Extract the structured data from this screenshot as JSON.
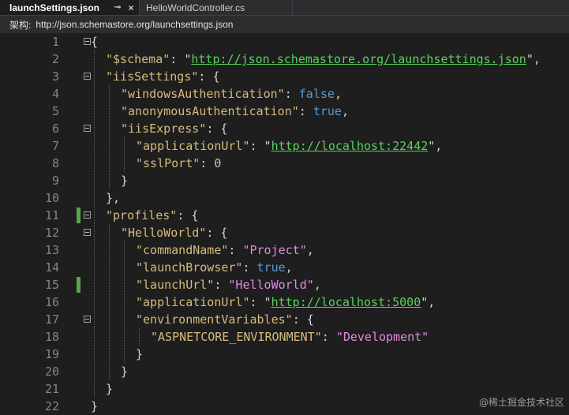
{
  "tabs": [
    {
      "label": "launchSettings.json",
      "pin_icon": "⊸",
      "close_icon": "×"
    },
    {
      "label": "HelloWorldController.cs"
    }
  ],
  "schema_bar": {
    "label": "架构:",
    "url": "http://json.schemastore.org/launchsettings.json"
  },
  "lines": [
    {
      "n": "1"
    },
    {
      "n": "2"
    },
    {
      "n": "3"
    },
    {
      "n": "4"
    },
    {
      "n": "5"
    },
    {
      "n": "6"
    },
    {
      "n": "7"
    },
    {
      "n": "8"
    },
    {
      "n": "9"
    },
    {
      "n": "10"
    },
    {
      "n": "11"
    },
    {
      "n": "12"
    },
    {
      "n": "13"
    },
    {
      "n": "14"
    },
    {
      "n": "15"
    },
    {
      "n": "16"
    },
    {
      "n": "17"
    },
    {
      "n": "18"
    },
    {
      "n": "19"
    },
    {
      "n": "20"
    },
    {
      "n": "21"
    },
    {
      "n": "22"
    }
  ],
  "code": {
    "schema_key": "\"$schema\"",
    "schema_val": "http://json.schemastore.org/launchsettings.json",
    "iis_key": "\"iisSettings\"",
    "winauth_key": "\"windowsAuthentication\"",
    "winauth_val": "false",
    "anon_key": "\"anonymousAuthentication\"",
    "anon_val": "true",
    "iisexpress_key": "\"iisExpress\"",
    "appurl_key": "\"applicationUrl\"",
    "appurl_val": "http://localhost:22442",
    "ssl_key": "\"sslPort\"",
    "ssl_val": "0",
    "profiles_key": "\"profiles\"",
    "hw_key": "\"HelloWorld\"",
    "cmd_key": "\"commandName\"",
    "cmd_val": "\"Project\"",
    "browser_key": "\"launchBrowser\"",
    "browser_val": "true",
    "launchurl_key": "\"launchUrl\"",
    "launchurl_val": "\"HelloWorld\"",
    "appurl2_key": "\"applicationUrl\"",
    "appurl2_val": "http://localhost:5000",
    "env_key": "\"environmentVariables\"",
    "aspenv_key": "\"ASPNETCORE_ENVIRONMENT\"",
    "aspenv_val": "\"Development\""
  },
  "watermark": "@稀土掘金技术社区"
}
